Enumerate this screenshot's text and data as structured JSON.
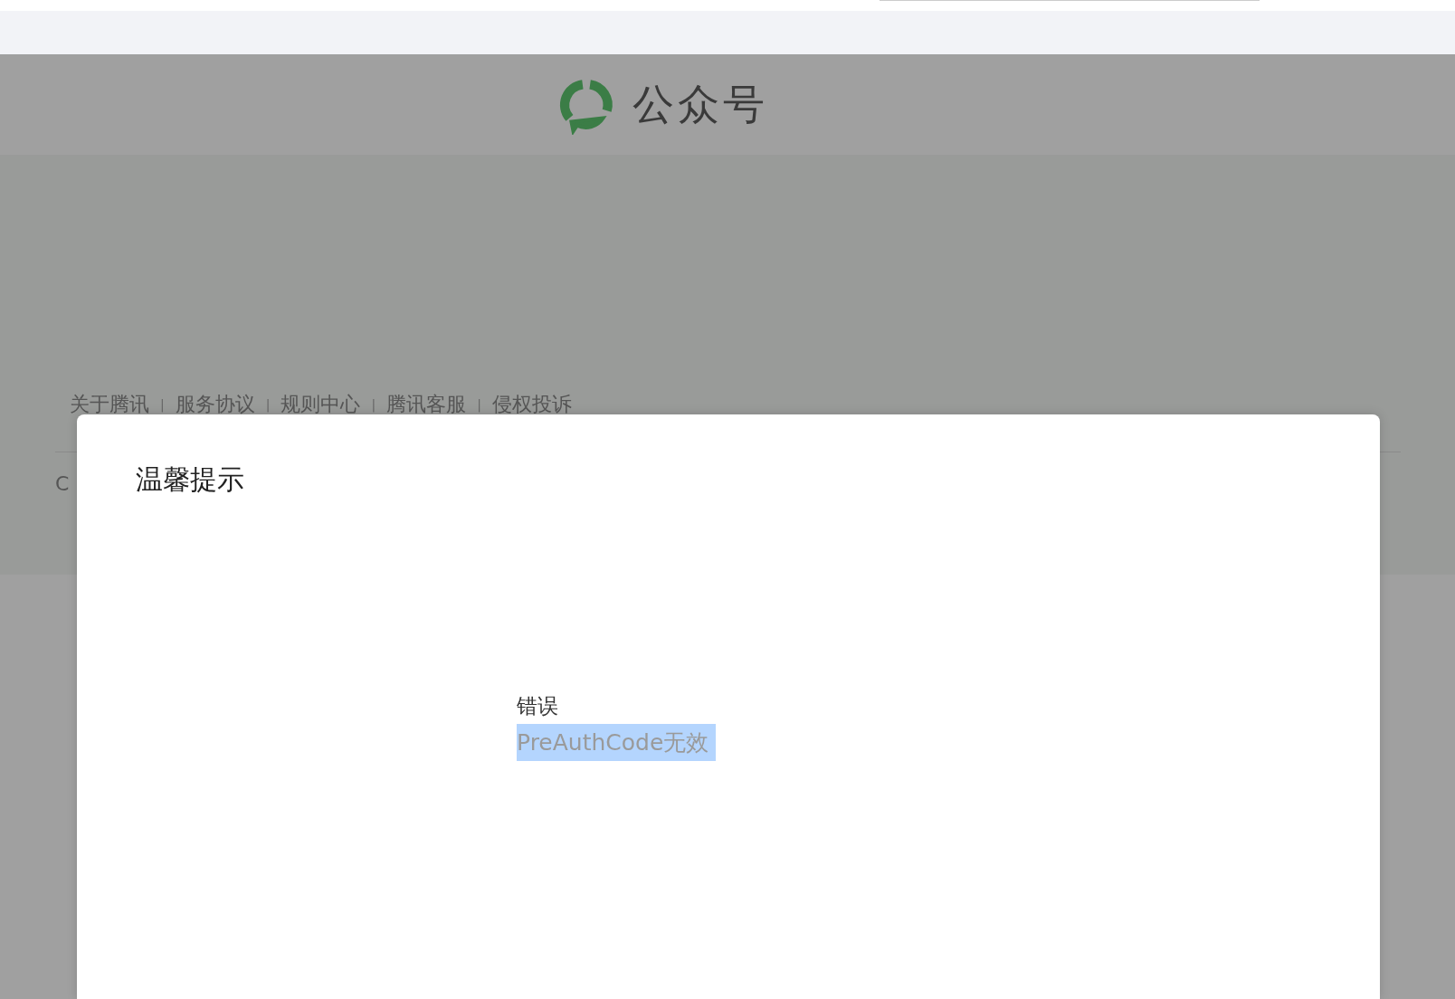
{
  "header": {
    "logo_text": "公众号"
  },
  "footer": {
    "links": [
      "关于腾讯",
      "服务协议",
      "规则中心",
      "腾讯客服",
      "侵权投诉"
    ],
    "separator": "|",
    "copyright": "C"
  },
  "dialog": {
    "title": "温馨提示",
    "message_title": "错误",
    "message": "PreAuthCode无效",
    "message_selected": true
  }
}
